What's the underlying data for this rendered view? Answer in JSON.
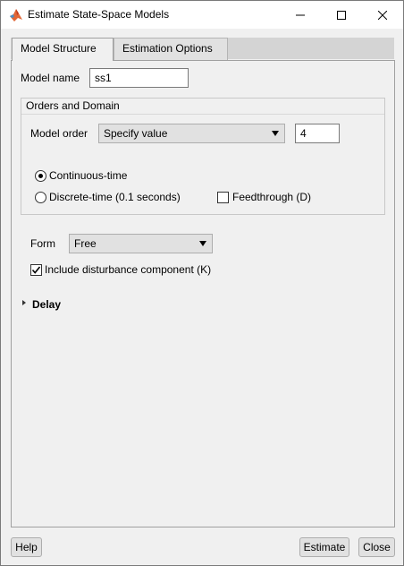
{
  "window": {
    "title": "Estimate State-Space Models"
  },
  "tabs": [
    {
      "label": "Model Structure",
      "selected": true
    },
    {
      "label": "Estimation Options",
      "selected": false
    }
  ],
  "model_name": {
    "label": "Model name",
    "value": "ss1"
  },
  "orders_group": {
    "title": "Orders and Domain",
    "model_order_label": "Model order",
    "model_order_mode": "Specify value",
    "model_order_value": "4",
    "continuous_label": "Continuous-time",
    "continuous_selected": true,
    "discrete_label": "Discrete-time (0.1 seconds)",
    "discrete_selected": false,
    "feedthrough_label": "Feedthrough (D)",
    "feedthrough_checked": false
  },
  "form": {
    "label": "Form",
    "value": "Free"
  },
  "disturbance": {
    "label": "Include disturbance component (K)",
    "checked": true
  },
  "delay": {
    "label": "Delay"
  },
  "buttons": {
    "help": "Help",
    "estimate": "Estimate",
    "close": "Close"
  }
}
